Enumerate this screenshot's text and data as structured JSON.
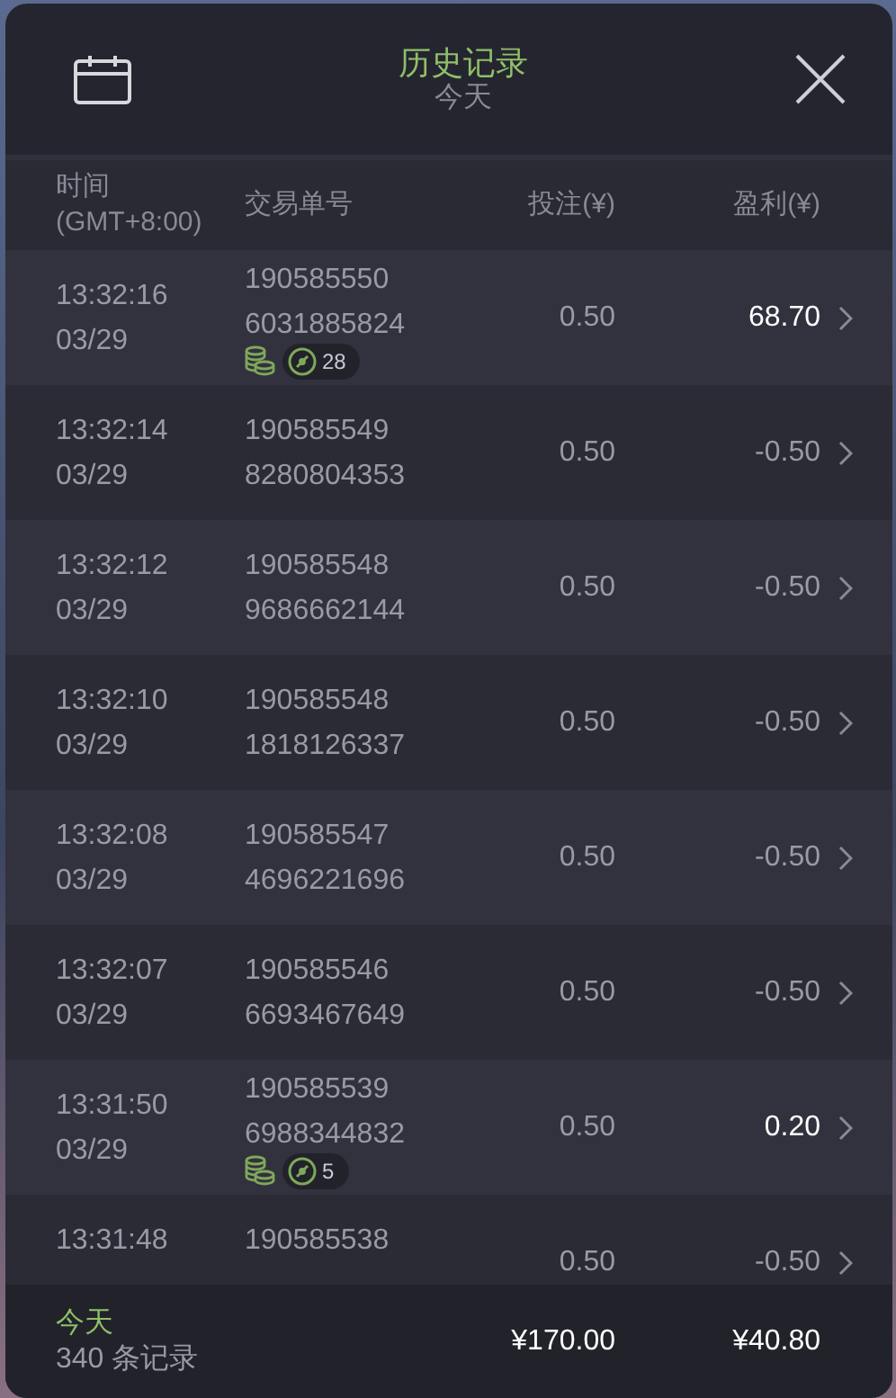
{
  "header": {
    "title": "历史记录",
    "subtitle": "今天"
  },
  "columns": [
    {
      "label": "时间\n(GMT+8:00)"
    },
    {
      "label": "交易单号"
    },
    {
      "label": "投注(¥)"
    },
    {
      "label": "盈利(¥)"
    }
  ],
  "rows": [
    {
      "time": "13:32:16",
      "date": "03/29",
      "order": [
        "190585550",
        "6031885824"
      ],
      "bet": "0.50",
      "profit": "68.70",
      "win": true,
      "tag_count": "28"
    },
    {
      "time": "13:32:14",
      "date": "03/29",
      "order": [
        "190585549",
        "8280804353"
      ],
      "bet": "0.50",
      "profit": "-0.50",
      "win": false
    },
    {
      "time": "13:32:12",
      "date": "03/29",
      "order": [
        "190585548",
        "9686662144"
      ],
      "bet": "0.50",
      "profit": "-0.50",
      "win": false
    },
    {
      "time": "13:32:10",
      "date": "03/29",
      "order": [
        "190585548",
        "1818126337"
      ],
      "bet": "0.50",
      "profit": "-0.50",
      "win": false
    },
    {
      "time": "13:32:08",
      "date": "03/29",
      "order": [
        "190585547",
        "4696221696"
      ],
      "bet": "0.50",
      "profit": "-0.50",
      "win": false
    },
    {
      "time": "13:32:07",
      "date": "03/29",
      "order": [
        "190585546",
        "6693467649"
      ],
      "bet": "0.50",
      "profit": "-0.50",
      "win": false
    },
    {
      "time": "13:31:50",
      "date": "03/29",
      "order": [
        "190585539",
        "6988344832"
      ],
      "bet": "0.50",
      "profit": "0.20",
      "win": true,
      "tag_count": "5"
    },
    {
      "time": "13:31:48",
      "order": [
        "190585538"
      ],
      "bet": "0.50",
      "profit": "-0.50",
      "win": false
    }
  ],
  "footer": {
    "period": "今天",
    "count": "340 条记录",
    "total_bet": "¥170.00",
    "total_profit": "¥40.80"
  }
}
